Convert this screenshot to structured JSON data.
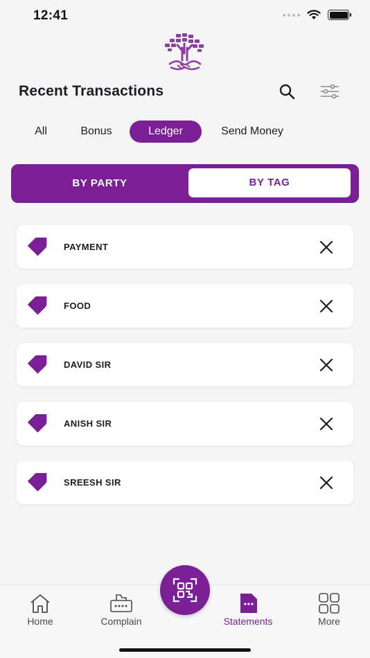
{
  "status_bar": {
    "time": "12:41"
  },
  "header": {
    "title": "Recent Transactions",
    "search_icon": "search-icon",
    "filter_icon": "sliders-icon"
  },
  "category_tabs": [
    {
      "label": "All",
      "active": false
    },
    {
      "label": "Bonus",
      "active": false
    },
    {
      "label": "Ledger",
      "active": true
    },
    {
      "label": "Send Money",
      "active": false
    }
  ],
  "segment": {
    "left_label": "BY PARTY",
    "right_label": "BY TAG",
    "selected": "BY TAG"
  },
  "tags": [
    {
      "label": "PAYMENT"
    },
    {
      "label": "FOOD"
    },
    {
      "label": "DAVID SIR"
    },
    {
      "label": "ANISH SIR"
    },
    {
      "label": "SREESH SIR"
    }
  ],
  "bottom_nav": {
    "items": [
      {
        "label": "Home",
        "icon": "home-icon"
      },
      {
        "label": "Complain",
        "icon": "complain-icon"
      },
      {
        "label": "Statements",
        "icon": "statements-icon",
        "active": true
      },
      {
        "label": "More",
        "icon": "grid-icon"
      }
    ],
    "fab_icon": "qr-code-icon"
  },
  "colors": {
    "accent": "#7a1f96",
    "background": "#f5f5f5",
    "card": "#ffffff",
    "text": "#1c1c24"
  }
}
